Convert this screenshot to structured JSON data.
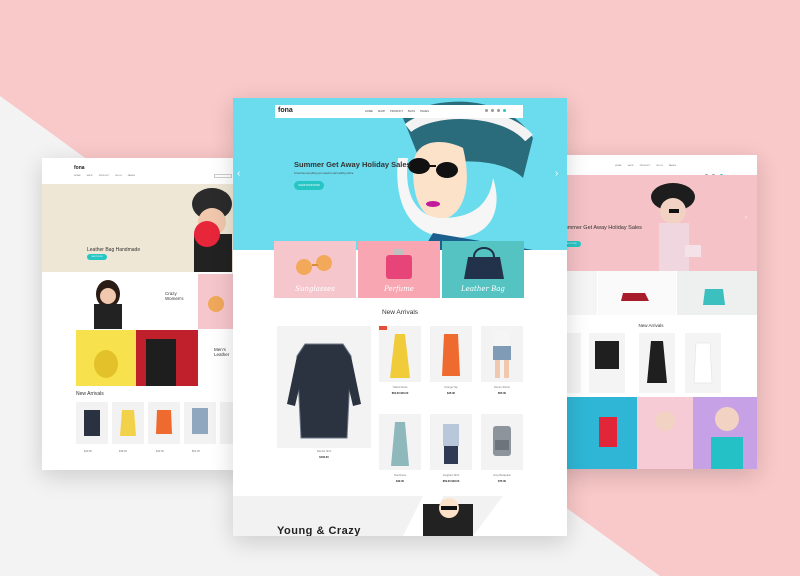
{
  "colors": {
    "accent": "#26c6c5",
    "pink_bg": "#f9c8c8",
    "sale": "#e74c3c"
  },
  "left": {
    "logo": "fona",
    "nav": [
      "HOME",
      "SHOP",
      "PRODUCT",
      "BLOG",
      "PAGES"
    ],
    "hero_title": "Leather Bag Handmade",
    "hero_button": "SHOP NOW",
    "promo1": "Crazy\nWomen's",
    "promo2": "Men's\nLeather",
    "arrivals_title": "New Arrivals",
    "prices": [
      "$40.00",
      "$38.00",
      "$32.00",
      "$51.00"
    ]
  },
  "right": {
    "nav": [
      "HOME",
      "SHOP",
      "PRODUCT",
      "BLOG",
      "PAGES"
    ],
    "hero_title": "Summer Get Away Holiday Sales",
    "hero_button": "SHOP NOW",
    "arrivals_title": "New Arrivals"
  },
  "center": {
    "logo": "fona",
    "nav": [
      "HOME",
      "SHOP",
      "PRODUCT",
      "BLOG",
      "PAGES"
    ],
    "hero_title": "Summer Get Away Holiday Sales",
    "hero_sub": "Fona has everything you need to start selling online.",
    "hero_button": "SHOP NOW NOW",
    "categories": [
      {
        "label": "Sunglasses",
        "color": "#f6c6cd"
      },
      {
        "label": "Perfume",
        "color": "#f7a6b2"
      },
      {
        "label": "Leather Bag",
        "color": "#55c3c2"
      }
    ],
    "arrivals_title": "New Arrivals",
    "featured": {
      "name": "Flannel Shirt",
      "price": "$100.00"
    },
    "products": [
      {
        "name": "Yellow Dress",
        "price": "$52.00 $46.00"
      },
      {
        "name": "Orange Top",
        "price": "$45.00"
      },
      {
        "name": "Denim Shorts",
        "price": "$55.00"
      },
      {
        "name": "Teal Dress",
        "price": "$42.00"
      },
      {
        "name": "Gingham Shirt",
        "price": "$59.00 $48.00"
      },
      {
        "name": "Grey Backpack",
        "price": "$75.00"
      }
    ],
    "young_title": "Young & Crazy"
  }
}
